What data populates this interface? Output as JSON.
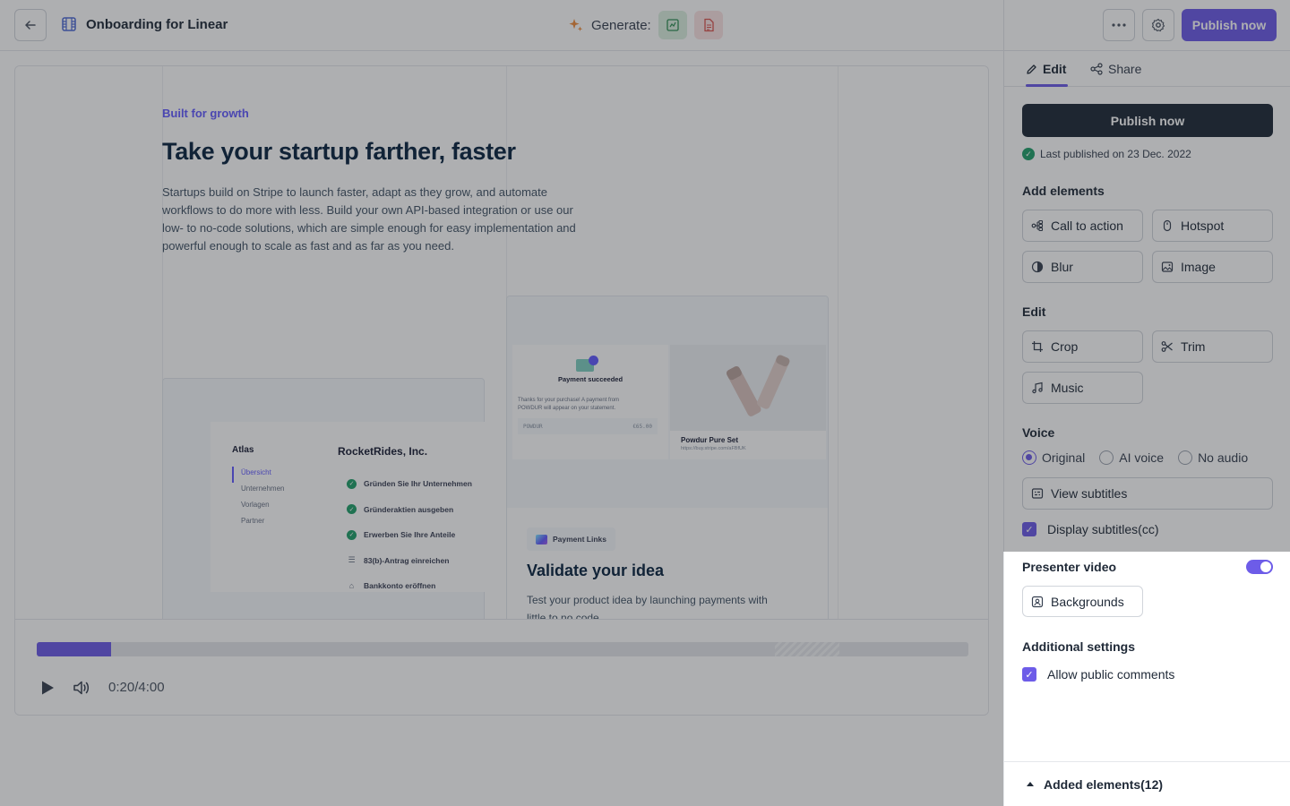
{
  "header": {
    "title": "Onboarding for Linear",
    "generate_label": "Generate:",
    "icons": {
      "back": "arrow-left-icon",
      "doc": "film-icon",
      "sparkle": "sparkle-icon",
      "gen_sheet": "spreadsheet-icon",
      "gen_doc": "document-icon"
    }
  },
  "video_content": {
    "eyebrow": "Built for growth",
    "headline": "Take your startup farther, faster",
    "body": "Startups build on Stripe to launch faster, adapt as they grow, and automate workflows to do more with less. Build your own API-based integration or use our low- to no-code solutions, which are simple enough for easy implementation and powerful enough to scale as fast and as far as you need.",
    "dashboard": {
      "brand": "Atlas",
      "nav": [
        "Übersicht",
        "Unternehmen",
        "Vorlagen",
        "Partner"
      ],
      "company": "RocketRides, Inc.",
      "steps": [
        {
          "label": "Gründen Sie Ihr Unternehmen",
          "done": true
        },
        {
          "label": "Gründeraktien ausgeben",
          "done": true
        },
        {
          "label": "Erwerben Sie Ihre Anteile",
          "done": true
        },
        {
          "label": "83(b)-Antrag einreichen",
          "done": false
        },
        {
          "label": "Bankkonto eröffnen",
          "done": false
        }
      ]
    },
    "payment": {
      "status": "Payment succeeded",
      "note": "Thanks for your purchase! A payment from POWDUR will appear on your statement.",
      "merchant": "POWDUR",
      "amount": "€65.00",
      "product_name": "Powdur Pure Set",
      "product_url": "https://buy.stripe.com/aFBfUK",
      "tag": "Payment Links",
      "title": "Validate your idea",
      "body": "Test your product idea by launching payments with little to no code."
    }
  },
  "player": {
    "time": "0:20/4:00",
    "progress": 0.08
  },
  "sidebar": {
    "publish_top": "Publish now",
    "tabs": [
      {
        "label": "Edit"
      },
      {
        "label": "Share"
      }
    ],
    "publish_main": "Publish now",
    "last_published": "Last published on 23 Dec. 2022",
    "add_elements": {
      "title": "Add elements",
      "items": [
        "Call to action",
        "Hotspot",
        "Blur",
        "Image"
      ]
    },
    "edit": {
      "title": "Edit",
      "items": [
        "Crop",
        "Trim",
        "Music"
      ]
    },
    "voice": {
      "title": "Voice",
      "options": [
        "Original",
        "AI voice",
        "No audio"
      ],
      "selected": "Original",
      "subtitles_button": "View subtitles",
      "display_subtitles": "Display subtitles(cc)"
    },
    "presenter": {
      "title": "Presenter video",
      "enabled": true,
      "backgrounds": "Backgrounds"
    },
    "additional": {
      "title": "Additional settings",
      "allow_comments": "Allow public comments"
    },
    "added_elements": "Added elements(12)"
  },
  "colors": {
    "accent": "#6d5ce8",
    "dark_button": "#1f2937",
    "success": "#22a06b",
    "stripe_purple": "#635bff"
  }
}
